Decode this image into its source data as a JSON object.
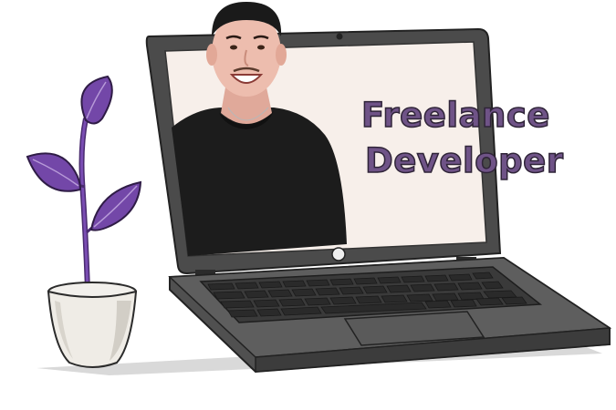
{
  "hero": {
    "headline_line1": "Freelance",
    "headline_line2": "Developer"
  },
  "colors": {
    "text": "#6f5387",
    "plant": "#6b3fa0",
    "laptop_body": "#4a4a4a",
    "screen_bg": "#f7efea"
  },
  "icons": [
    "plant-illustration",
    "laptop-illustration",
    "person-photo"
  ]
}
